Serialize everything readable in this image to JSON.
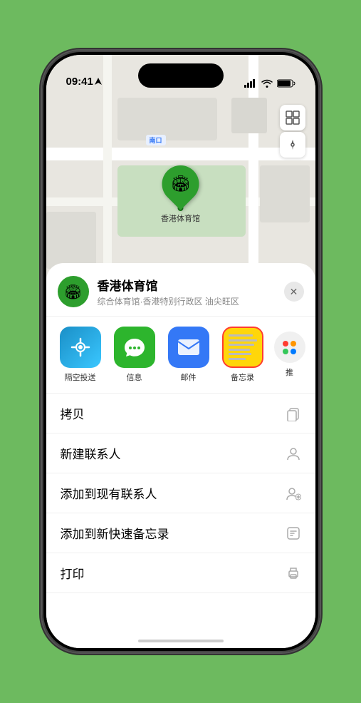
{
  "status_bar": {
    "time": "09:41",
    "location_arrow": "▶"
  },
  "map": {
    "label_south": "南口",
    "label_prefix": "南口"
  },
  "pin": {
    "label": "香港体育馆"
  },
  "location_card": {
    "name": "香港体育馆",
    "subtitle": "综合体育馆·香港特别行政区 油尖旺区",
    "close_label": "✕"
  },
  "share_apps": [
    {
      "id": "airdrop",
      "label": "隔空投送",
      "icon_type": "airdrop"
    },
    {
      "id": "messages",
      "label": "信息",
      "icon_type": "messages"
    },
    {
      "id": "mail",
      "label": "邮件",
      "icon_type": "mail"
    },
    {
      "id": "notes",
      "label": "备忘录",
      "icon_type": "notes"
    },
    {
      "id": "more",
      "label": "推",
      "icon_type": "more"
    }
  ],
  "actions": [
    {
      "id": "copy",
      "label": "拷贝",
      "icon": "📋"
    },
    {
      "id": "new-contact",
      "label": "新建联系人",
      "icon": "👤"
    },
    {
      "id": "add-existing",
      "label": "添加到现有联系人",
      "icon": "👤"
    },
    {
      "id": "add-notes",
      "label": "添加到新快速备忘录",
      "icon": "📝"
    },
    {
      "id": "print",
      "label": "打印",
      "icon": "🖨"
    }
  ],
  "colors": {
    "green": "#2d9e2d",
    "selected_border": "#ff3b30",
    "background": "#6dba5f"
  }
}
